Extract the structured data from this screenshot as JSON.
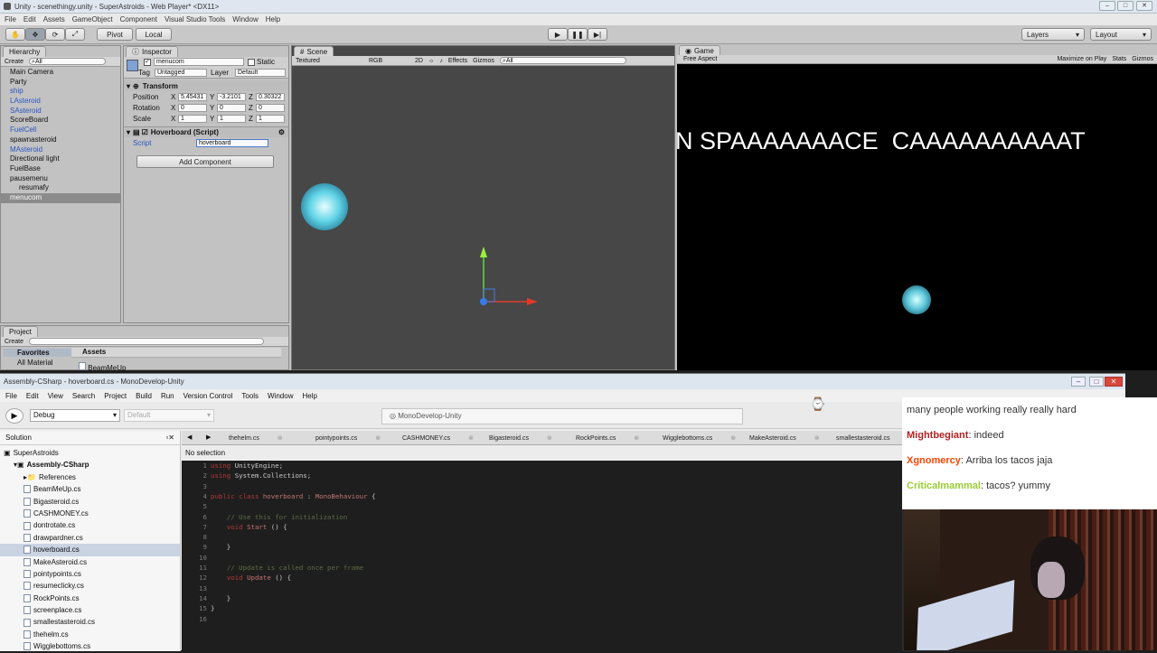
{
  "unity": {
    "title": "Unity - scenethingy.unity - SuperAstroids - Web Player* <DX11>",
    "menu": [
      "File",
      "Edit",
      "Assets",
      "GameObject",
      "Component",
      "Visual Studio Tools",
      "Window",
      "Help"
    ],
    "toolbar": {
      "pivot": "Pivot",
      "local": "Local",
      "layers": "Layers",
      "layout": "Layout"
    },
    "hierarchy": {
      "tab": "Hierarchy",
      "create": "Create",
      "search_placeholder": "All",
      "items": [
        {
          "label": "Main Camera",
          "blue": false
        },
        {
          "label": "Party",
          "blue": false
        },
        {
          "label": "ship",
          "blue": true
        },
        {
          "label": "LAsteroid",
          "blue": true
        },
        {
          "label": "SAsteroid",
          "blue": true
        },
        {
          "label": "ScoreBoard",
          "blue": false
        },
        {
          "label": "FuelCell",
          "blue": true
        },
        {
          "label": "spawnasteroid",
          "blue": false
        },
        {
          "label": "MAsteroid",
          "blue": true
        },
        {
          "label": "Directional light",
          "blue": false
        },
        {
          "label": "FuelBase",
          "blue": false
        },
        {
          "label": "pausemenu",
          "blue": false
        },
        {
          "label": "resumafy",
          "blue": false
        },
        {
          "label": "menucom",
          "blue": false
        }
      ]
    },
    "inspector": {
      "tab": "Inspector",
      "object_name": "menucom",
      "static_label": "Static",
      "tag_label": "Tag",
      "tag_value": "Untagged",
      "layer_label": "Layer",
      "layer_value": "Default",
      "transform_label": "Transform",
      "position_label": "Position",
      "pos": {
        "x": "5.45431",
        "y": "-3.2101",
        "z": "0.30322"
      },
      "rotation_label": "Rotation",
      "rot": {
        "x": "0",
        "y": "0",
        "z": "0"
      },
      "scale_label": "Scale",
      "scl": {
        "x": "1",
        "y": "1",
        "z": "1"
      },
      "script_component": "Hoverboard (Script)",
      "script_label": "Script",
      "script_value": "hoverboard",
      "add_component": "Add Component"
    },
    "scene": {
      "tab": "Scene",
      "shading": "Textured",
      "rgb": "RGB",
      "twod": "2D",
      "effects": "Effects",
      "gizmos": "Gizmos",
      "search": "All"
    },
    "game": {
      "tab": "Game",
      "aspect": "Free Aspect",
      "maximize": "Maximize on Play",
      "stats": "Stats",
      "gizmos": "Gizmos",
      "banner": "N SPAAAAAAACE  CAAAAAAAAAAT"
    },
    "project": {
      "tab": "Project",
      "create": "Create",
      "favorites": "Favorites",
      "assets": "Assets",
      "all_material": "All Material",
      "asset_item": "BeamMeUp"
    }
  },
  "md": {
    "title": "Assembly-CSharp - hoverboard.cs - MonoDevelop-Unity",
    "menu": [
      "File",
      "Edit",
      "View",
      "Search",
      "Project",
      "Build",
      "Run",
      "Version Control",
      "Tools",
      "Window",
      "Help"
    ],
    "config": "Debug",
    "platform": "Default",
    "status": "MonoDevelop-Unity",
    "solution_label": "Solution",
    "no_selection": "No selection",
    "tree": [
      {
        "label": "SuperAstroids",
        "indent": 0,
        "bold": false,
        "kind": "sln"
      },
      {
        "label": "Assembly-CSharp",
        "indent": 1,
        "bold": true,
        "kind": "proj"
      },
      {
        "label": "References",
        "indent": 2,
        "bold": false,
        "kind": "folder"
      },
      {
        "label": "BeamMeUp.cs",
        "indent": 2,
        "bold": false,
        "kind": "file"
      },
      {
        "label": "Bigasteroid.cs",
        "indent": 2,
        "bold": false,
        "kind": "file"
      },
      {
        "label": "CASHMONEY.cs",
        "indent": 2,
        "bold": false,
        "kind": "file"
      },
      {
        "label": "dontrotate.cs",
        "indent": 2,
        "bold": false,
        "kind": "file"
      },
      {
        "label": "drawpardner.cs",
        "indent": 2,
        "bold": false,
        "kind": "file"
      },
      {
        "label": "hoverboard.cs",
        "indent": 2,
        "bold": false,
        "kind": "file",
        "selected": true
      },
      {
        "label": "MakeAsteroid.cs",
        "indent": 2,
        "bold": false,
        "kind": "file"
      },
      {
        "label": "pointypoints.cs",
        "indent": 2,
        "bold": false,
        "kind": "file"
      },
      {
        "label": "resumeclicky.cs",
        "indent": 2,
        "bold": false,
        "kind": "file"
      },
      {
        "label": "RockPoints.cs",
        "indent": 2,
        "bold": false,
        "kind": "file"
      },
      {
        "label": "screenplace.cs",
        "indent": 2,
        "bold": false,
        "kind": "file"
      },
      {
        "label": "smallestasteroid.cs",
        "indent": 2,
        "bold": false,
        "kind": "file"
      },
      {
        "label": "thehelm.cs",
        "indent": 2,
        "bold": false,
        "kind": "file"
      },
      {
        "label": "Wigglebottoms.cs",
        "indent": 2,
        "bold": false,
        "kind": "file"
      }
    ],
    "tabs": [
      "thehelm.cs",
      "pointypoints.cs",
      "CASHMONEY.cs",
      "Bigasteroid.cs",
      "RockPoints.cs",
      "Wigglebottoms.cs",
      "MakeAsteroid.cs",
      "smallestasteroid.cs"
    ],
    "code": [
      {
        "n": "1",
        "html": "<span class='kw'>using</span> UnityEngine;"
      },
      {
        "n": "2",
        "html": "<span class='kw'>using</span> System.Collections;"
      },
      {
        "n": "3",
        "html": ""
      },
      {
        "n": "4",
        "html": "<span class='kw'>public class</span> <span class='ty'>hoverboard</span> : <span class='ty'>MonoBehaviour</span> {"
      },
      {
        "n": "5",
        "html": ""
      },
      {
        "n": "6",
        "html": "    <span class='cm'>// Use this for initialization</span>"
      },
      {
        "n": "7",
        "html": "    <span class='kw'>void</span> <span class='ty'>Start</span> () {"
      },
      {
        "n": "8",
        "html": ""
      },
      {
        "n": "9",
        "html": "    }"
      },
      {
        "n": "10",
        "html": ""
      },
      {
        "n": "11",
        "html": "    <span class='cm'>// Update is called once per frame</span>"
      },
      {
        "n": "12",
        "html": "    <span class='kw'>void</span> <span class='ty'>Update</span> () {"
      },
      {
        "n": "13",
        "html": ""
      },
      {
        "n": "14",
        "html": "    }"
      },
      {
        "n": "15",
        "html": "}"
      },
      {
        "n": "16",
        "html": ""
      }
    ]
  },
  "chat": [
    {
      "user": "",
      "text": "many people working really really hard",
      "color": "#333333"
    },
    {
      "user": "Mightbegiant",
      "text": "indeed",
      "color": "#b22222"
    },
    {
      "user": "Xgnomercy",
      "text": "Arriba los tacos jaja",
      "color": "#ff4500"
    },
    {
      "user": "Criticalmammal",
      "text": "tacos? yummy",
      "color": "#9acd32"
    }
  ]
}
